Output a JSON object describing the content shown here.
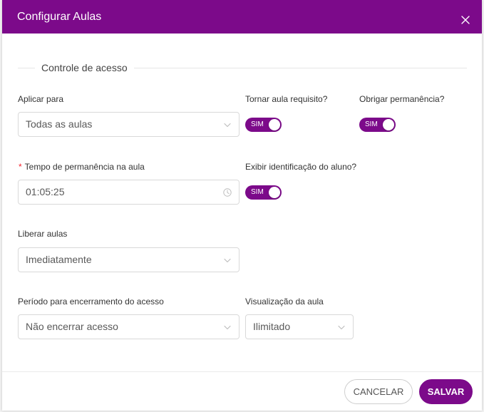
{
  "modal": {
    "title": "Configurar Aulas",
    "close_icon": "close-icon"
  },
  "section": {
    "legend": "Controle de acesso"
  },
  "fields": {
    "aplicar_para": {
      "label": "Aplicar para",
      "value": "Todas as aulas",
      "icon": "chevron-down-icon"
    },
    "tornar_requisito": {
      "label": "Tornar aula requisito?",
      "toggle_text": "SIM",
      "checked": true
    },
    "obrigar_permanencia": {
      "label": "Obrigar permanência?",
      "toggle_text": "SIM",
      "checked": true
    },
    "tempo_permanencia": {
      "required_mark": "*",
      "label": "Tempo de permanência na aula",
      "value": "01:05:25",
      "icon": "clock-icon"
    },
    "exibir_identificacao": {
      "label": "Exibir identificação do aluno?",
      "toggle_text": "SIM",
      "checked": true
    },
    "liberar_aulas": {
      "label": "Liberar aulas",
      "value": "Imediatamente",
      "icon": "chevron-down-icon"
    },
    "periodo_encerramento": {
      "label": "Período para encerramento do acesso",
      "value": "Não encerrar acesso",
      "icon": "chevron-down-icon"
    },
    "visualizacao": {
      "label": "Visualização da aula",
      "value": "Ilimitado",
      "icon": "chevron-down-icon"
    }
  },
  "footer": {
    "cancel_label": "CANCELAR",
    "save_label": "SALVAR"
  },
  "colors": {
    "primary": "#7c0a8a",
    "required": "#f5222d",
    "input_border": "#d9d9d9",
    "label_text": "#333333",
    "value_text": "#595959"
  }
}
